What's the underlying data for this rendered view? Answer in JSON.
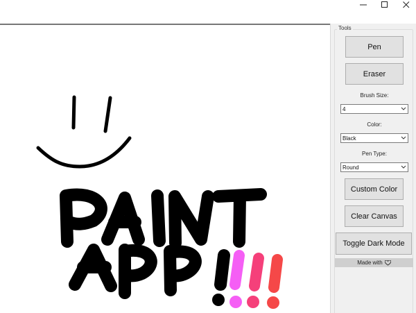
{
  "window": {
    "controls": [
      "minimize-icon",
      "maximize-icon",
      "close-icon"
    ]
  },
  "sidebar": {
    "group_title": "Tools",
    "pen_label": "Pen",
    "eraser_label": "Eraser",
    "brush_size_label": "Brush Size:",
    "brush_size_value": "4",
    "color_label": "Color:",
    "color_value": "Black",
    "pen_type_label": "Pen Type:",
    "pen_type_value": "Round",
    "custom_color_label": "Custom Color",
    "clear_canvas_label": "Clear Canvas",
    "toggle_dark_label": "Toggle Dark Mode",
    "made_with_label": "Made with",
    "made_with_icon": "heart-icon"
  },
  "canvas": {
    "drawing_text": [
      "PAINT",
      "APP",
      "!!!!"
    ],
    "stroke_colors": {
      "black": "#000000",
      "pink": "#f55ef5",
      "rose": "#f5407a",
      "coral": "#f54848"
    }
  }
}
